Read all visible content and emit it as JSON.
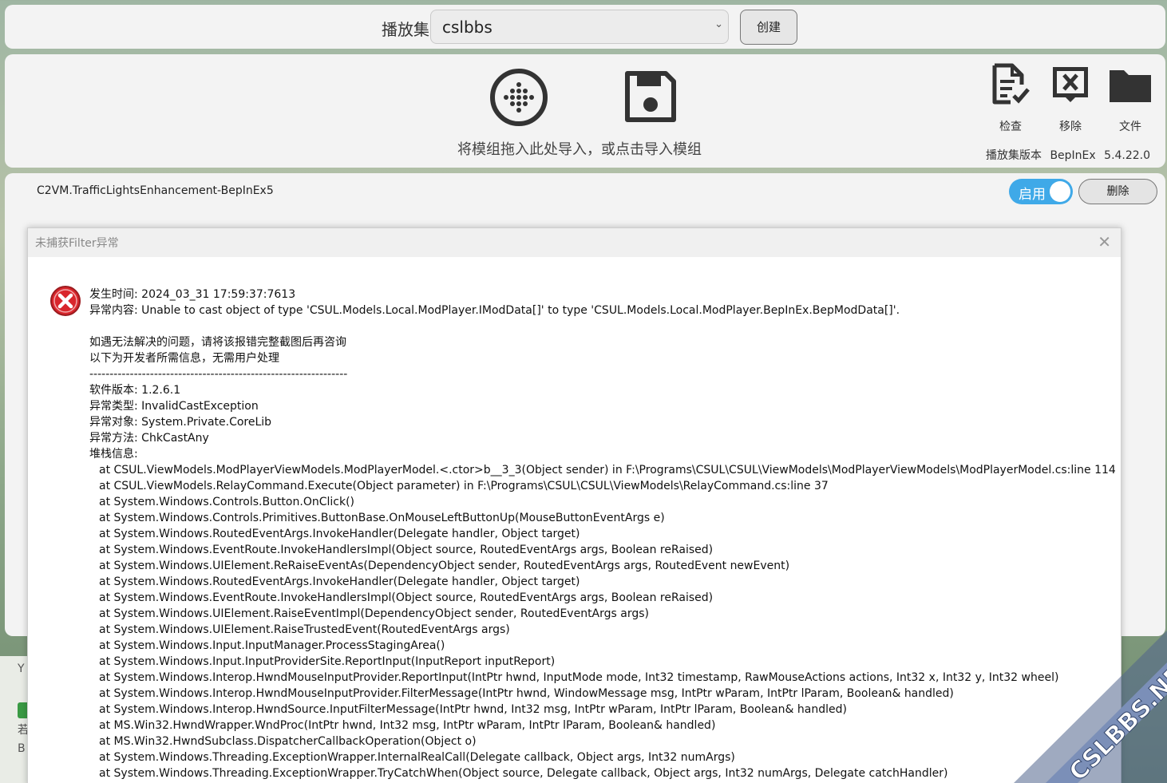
{
  "topbar": {
    "playset_label": "播放集",
    "playset_value": "cslbbs",
    "create_label": "创建"
  },
  "import_panel": {
    "hint": "将模组拖入此处导入，或点击导入模组",
    "tools": {
      "check": "检查",
      "remove": "移除",
      "file": "文件"
    },
    "version_label": "播放集版本",
    "version_loader": "BepInEx",
    "version_number": "5.4.22.0"
  },
  "mod_item": {
    "name": "C2VM.TrafficLightsEnhancement-BepInEx5",
    "enable_label": "启用",
    "delete_label": "删除"
  },
  "side": {
    "t1": "Y",
    "t2": "若",
    "t3": "B"
  },
  "dialog": {
    "title": "未捕获Filter异常",
    "occur_time": "发生时间: 2024_03_31 17:59:37:7613",
    "content": "异常内容: Unable to cast object of type 'CSUL.Models.Local.ModPlayer.IModData[]' to type 'CSUL.Models.Local.ModPlayer.BepInEx.BepModData[]'.",
    "advice1": "如遇无法解决的问题，请将该报错完整截图后再咨询",
    "advice2": "以下为开发者所需信息，无需用户处理",
    "separator": "----------------------------------------------------------------",
    "software_version": "软件版本: 1.2.6.1",
    "exception_type": "异常类型: InvalidCastException",
    "exception_object": "异常对象: System.Private.CoreLib",
    "exception_method": "异常方法: ChkCastAny",
    "stack_label": "堆栈信息:",
    "stack": [
      "at CSUL.ViewModels.ModPlayerViewModels.ModPlayerModel.<.ctor>b__3_3(Object sender) in F:\\Programs\\CSUL\\CSUL\\ViewModels\\ModPlayerViewModels\\ModPlayerModel.cs:line 114",
      "at CSUL.ViewModels.RelayCommand.Execute(Object parameter) in F:\\Programs\\CSUL\\CSUL\\ViewModels\\RelayCommand.cs:line 37",
      "at System.Windows.Controls.Button.OnClick()",
      "at System.Windows.Controls.Primitives.ButtonBase.OnMouseLeftButtonUp(MouseButtonEventArgs e)",
      "at System.Windows.RoutedEventArgs.InvokeHandler(Delegate handler, Object target)",
      "at System.Windows.EventRoute.InvokeHandlersImpl(Object source, RoutedEventArgs args, Boolean reRaised)",
      "at System.Windows.UIElement.ReRaiseEventAs(DependencyObject sender, RoutedEventArgs args, RoutedEvent newEvent)",
      "at System.Windows.RoutedEventArgs.InvokeHandler(Delegate handler, Object target)",
      "at System.Windows.EventRoute.InvokeHandlersImpl(Object source, RoutedEventArgs args, Boolean reRaised)",
      "at System.Windows.UIElement.RaiseEventImpl(DependencyObject sender, RoutedEventArgs args)",
      "at System.Windows.UIElement.RaiseTrustedEvent(RoutedEventArgs args)",
      "at System.Windows.Input.InputManager.ProcessStagingArea()",
      "at System.Windows.Input.InputProviderSite.ReportInput(InputReport inputReport)",
      "at System.Windows.Interop.HwndMouseInputProvider.ReportInput(IntPtr hwnd, InputMode mode, Int32 timestamp, RawMouseActions actions, Int32 x, Int32 y, Int32 wheel)",
      "at System.Windows.Interop.HwndMouseInputProvider.FilterMessage(IntPtr hwnd, WindowMessage msg, IntPtr wParam, IntPtr lParam, Boolean& handled)",
      "at System.Windows.Interop.HwndSource.InputFilterMessage(IntPtr hwnd, Int32 msg, IntPtr wParam, IntPtr lParam, Boolean& handled)",
      "at MS.Win32.HwndWrapper.WndProc(IntPtr hwnd, Int32 msg, IntPtr wParam, IntPtr lParam, Boolean& handled)",
      "at MS.Win32.HwndSubclass.DispatcherCallbackOperation(Object o)",
      "at System.Windows.Threading.ExceptionWrapper.InternalRealCall(Delegate callback, Object args, Int32 numArgs)",
      "at System.Windows.Threading.ExceptionWrapper.TryCatchWhen(Object source, Delegate callback, Object args, Int32 numArgs, Delegate catchHandler)"
    ]
  },
  "watermark": {
    "text": "CSLBBS.NET"
  },
  "colors": {
    "accent": "#3fa9e8",
    "error": "#d9262c"
  }
}
